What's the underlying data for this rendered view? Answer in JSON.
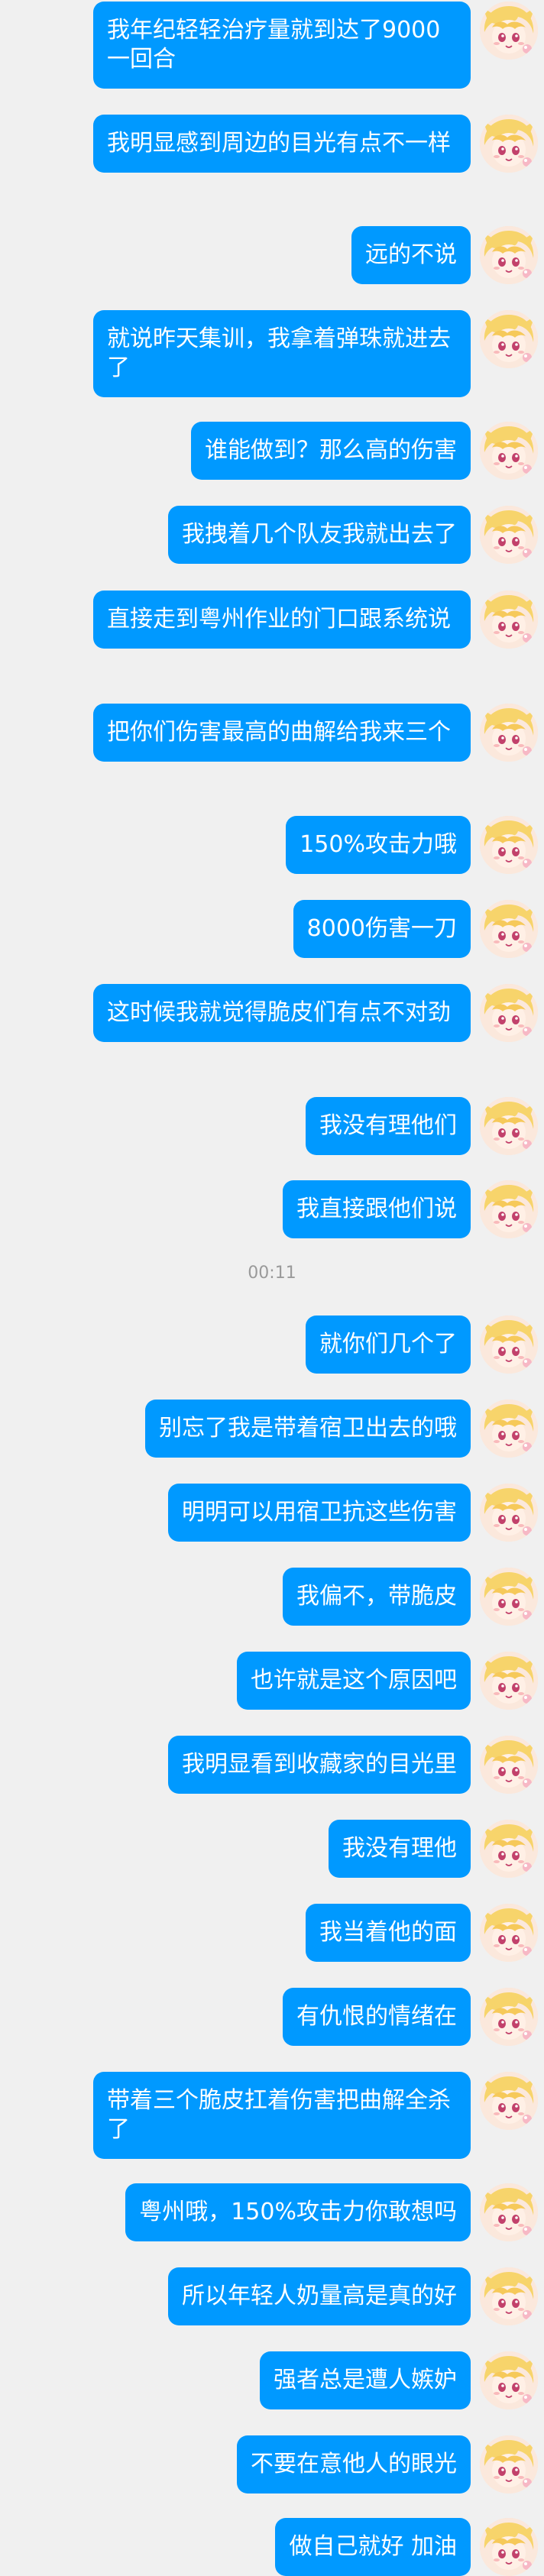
{
  "messages": [
    {
      "text": "我年纪轻轻治疗量就到达了9000一回合"
    },
    {
      "text": "我明显感到周边的目光有点不一样"
    },
    {
      "text": "远的不说"
    },
    {
      "text": "就说昨天集训，我拿着弹珠就进去了"
    },
    {
      "text": "谁能做到？那么高的伤害"
    },
    {
      "text": "我拽着几个队友我就出去了"
    },
    {
      "text": "直接走到粤州作业的门口跟系统说"
    },
    {
      "text": "把你们伤害最高的曲解给我来三个"
    },
    {
      "text": "150%攻击力哦"
    },
    {
      "text": "8000伤害一刀"
    },
    {
      "text": "这时候我就觉得脆皮们有点不对劲"
    },
    {
      "text": "我没有理他们"
    },
    {
      "text": "我直接跟他们说"
    },
    {
      "text": "就你们几个了"
    },
    {
      "text": "别忘了我是带着宿卫出去的哦"
    },
    {
      "text": "明明可以用宿卫抗这些伤害"
    },
    {
      "text": "我偏不，带脆皮"
    },
    {
      "text": "也许就是这个原因吧"
    },
    {
      "text": "我明显看到收藏家的目光里"
    },
    {
      "text": "我没有理他"
    },
    {
      "text": "我当着他的面"
    },
    {
      "text": "有仇恨的情绪在"
    },
    {
      "text": "带着三个脆皮扛着伤害把曲解全杀了"
    },
    {
      "text": "粤州哦，150%攻击力你敢想吗"
    },
    {
      "text": "所以年轻人奶量高是真的好"
    },
    {
      "text": "强者总是遭人嫉妒"
    },
    {
      "text": "不要在意他人的眼光"
    },
    {
      "text": "做自己就好 加油"
    }
  ],
  "timestamp": "00:11",
  "colors": {
    "bubble": "#0099ff",
    "bubble_text": "#ffffff",
    "background": "#f0f0f0",
    "timestamp": "#9a9a9a"
  },
  "avatar_icon": "anime-girl-avatar-icon"
}
